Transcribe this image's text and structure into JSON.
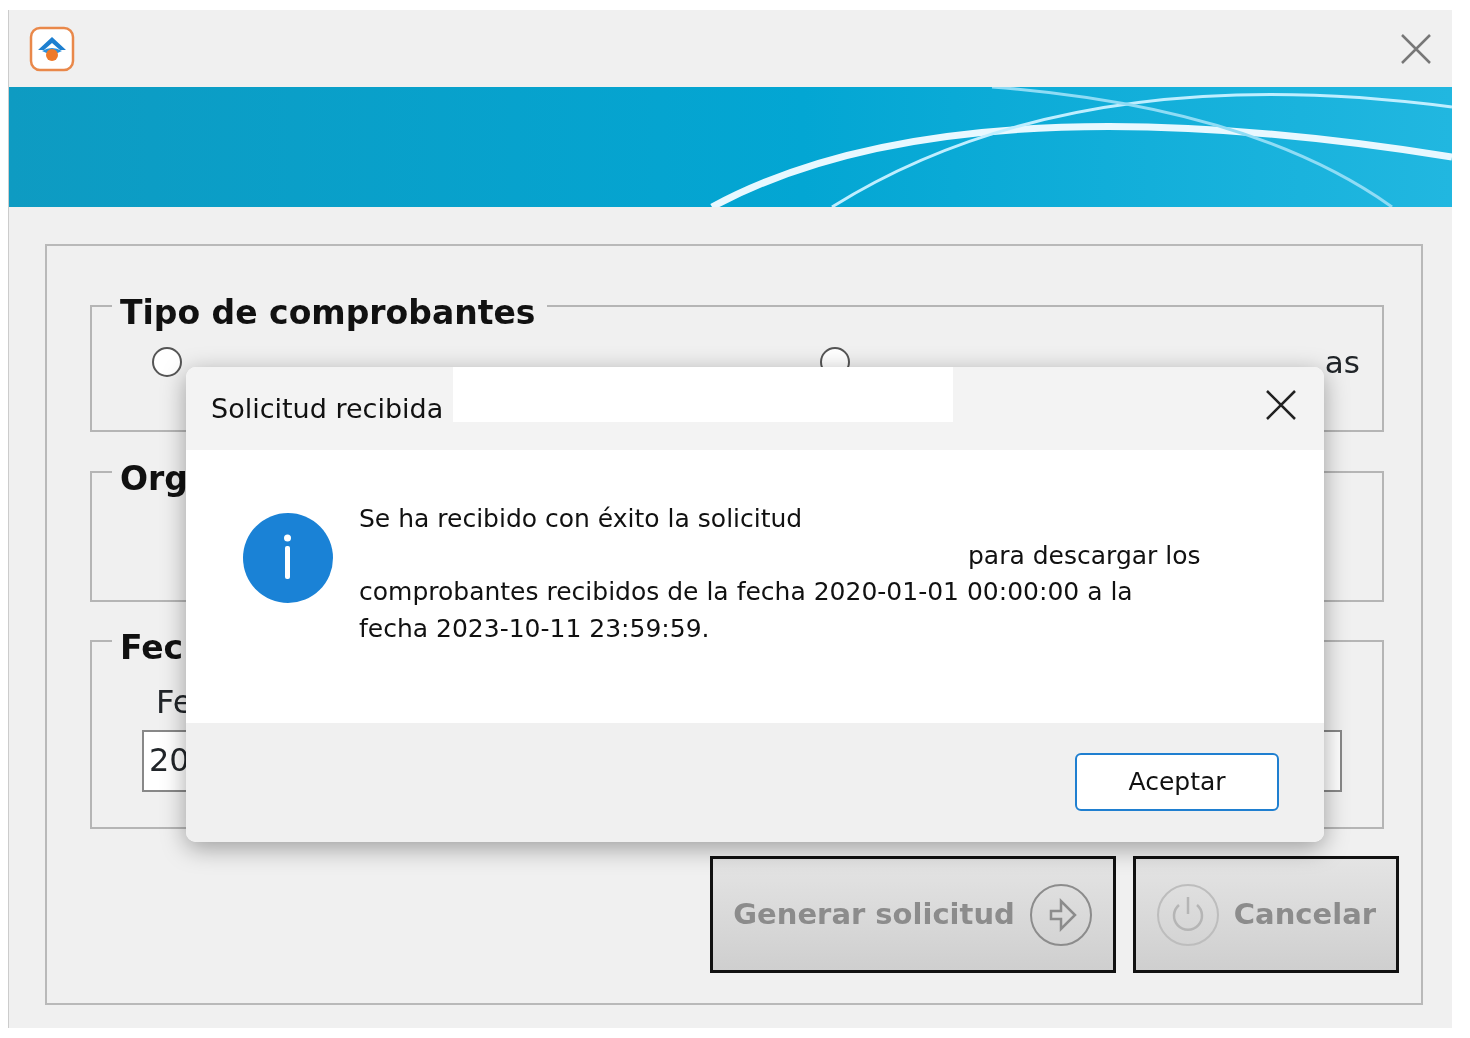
{
  "groups": [
    {
      "kind": "radios",
      "title": "Tipo de comprobantes",
      "options": [
        {
          "selected": false
        },
        {
          "label": "as",
          "selected": false
        }
      ]
    },
    {
      "kind": "plain",
      "title": "Org"
    },
    {
      "kind": "date",
      "title": "Fec",
      "field_label": "Fe",
      "value": "20"
    }
  ],
  "buttons": [
    {
      "label": "Generar solicitud",
      "kind": "next",
      "disabled": true
    },
    {
      "label": "Cancelar",
      "kind": "power",
      "disabled": true
    }
  ],
  "dialog": {
    "title": "Solicitud recibida",
    "message_lines": [
      {
        "text": "Se ha recibido con éxito la solicitud",
        "indented": false
      },
      {
        "text": "para descargar los",
        "indented": true
      },
      {
        "text": "comprobantes recibidos de la fecha 2020-01-01 00:00:00 a la",
        "indented": false
      },
      {
        "text": "fecha 2023-10-11 23:59:59.",
        "indented": false
      }
    ],
    "buttons": [
      {
        "label": "Aceptar",
        "default": true
      }
    ]
  }
}
